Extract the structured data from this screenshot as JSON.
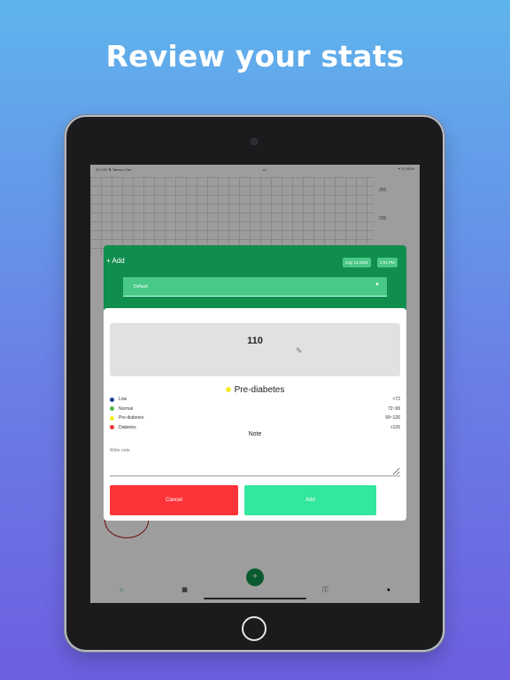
{
  "headline": "Review your stats",
  "status_bar": {
    "left": "09 2:01  ⇅ Tarrecc Con",
    "center": "•••",
    "right": "ᯤ ⚲ 100%"
  },
  "chart_axis": {
    "top_label": "250",
    "second_label": "200"
  },
  "header": {
    "add_label": "+ Add",
    "date_chip": "July 14,2023",
    "time_chip": "2:01 PM",
    "dropdown_value": "Default"
  },
  "reading": {
    "value": "110"
  },
  "status": {
    "label": "Pre-diabetes",
    "color": "#f5ea2a"
  },
  "ranges": [
    {
      "label": "Low",
      "range": "<72",
      "color": "#1f3f9e"
    },
    {
      "label": "Normal",
      "range": "72~99",
      "color": "#4fb84f"
    },
    {
      "label": "Pre-diabetes",
      "range": "99~126",
      "color": "#f5ea2a"
    },
    {
      "label": "Diabetes",
      "range": ">126",
      "color": "#e83a2e"
    }
  ],
  "note": {
    "title": "Note",
    "placeholder": "Write note"
  },
  "buttons": {
    "cancel": "Cancel",
    "add": "Add"
  },
  "tabbar": {
    "icons": [
      "home-icon",
      "calendar-icon",
      "info-icon",
      "profile-icon"
    ]
  },
  "colors": {
    "header_green": "#0f8e4e",
    "cancel_red": "#fc3338",
    "add_green": "#33e79d"
  }
}
